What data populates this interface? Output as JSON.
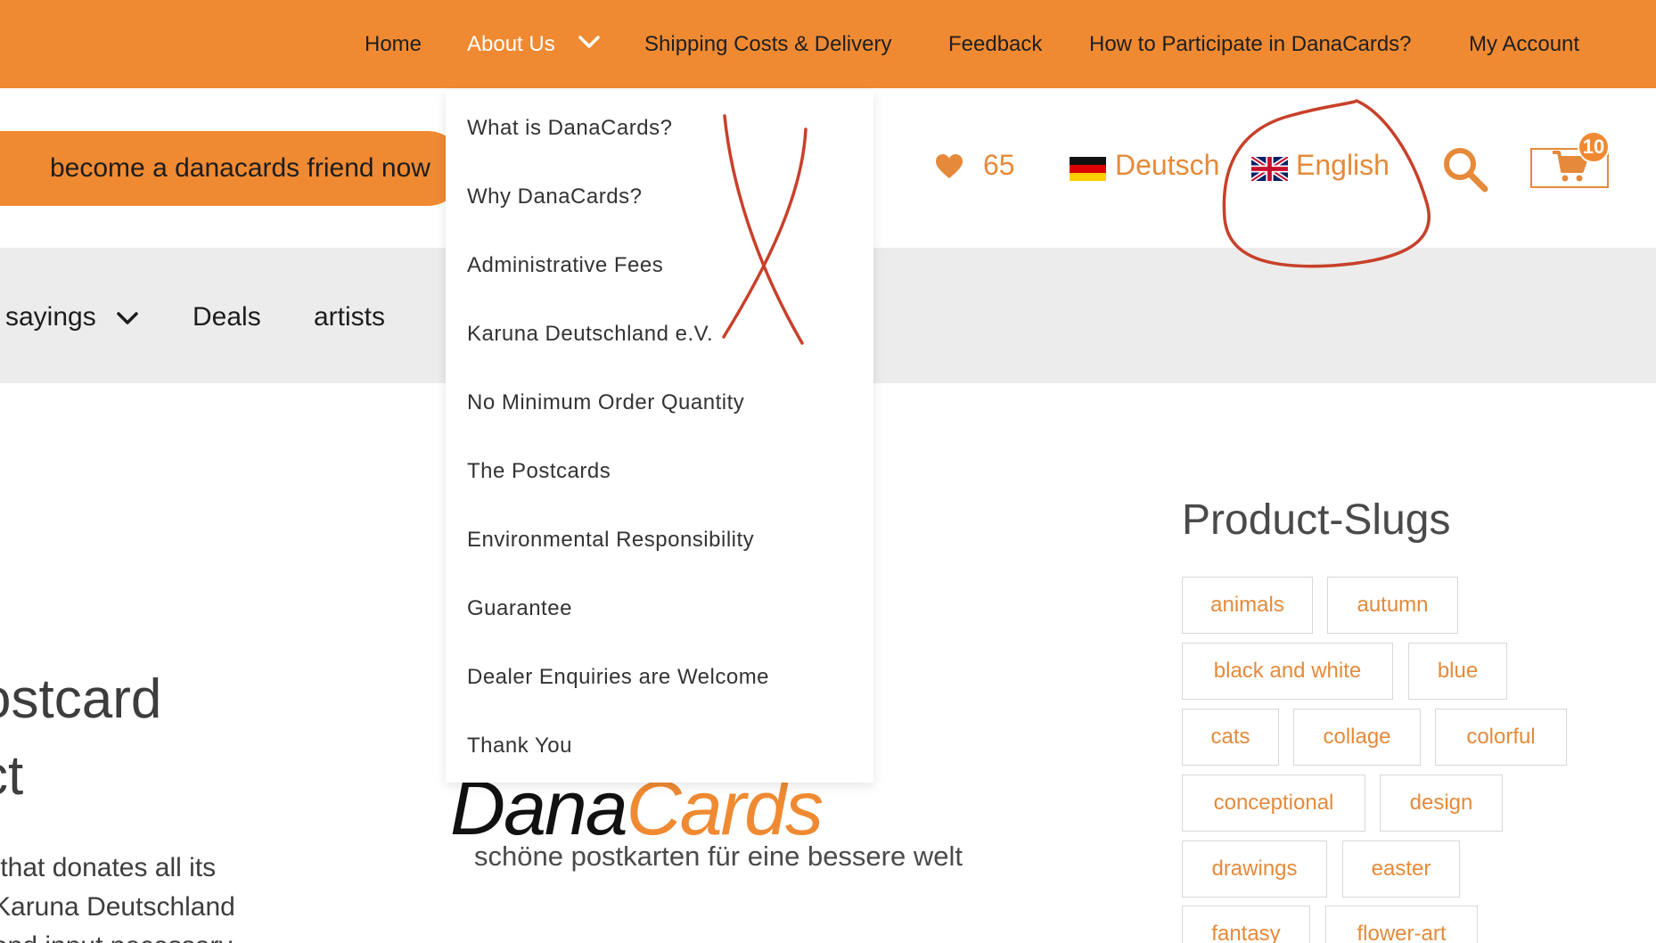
{
  "topnav": {
    "items": [
      "Home",
      "About Us",
      "Shipping Costs & Delivery",
      "Feedback",
      "How to Participate in DanaCards?",
      "My Account"
    ]
  },
  "about_menu": {
    "items": [
      "What is DanaCards?",
      "Why DanaCards?",
      "Administrative Fees",
      "Karuna Deutschland e.V.",
      "No Minimum Order Quantity",
      "The Postcards",
      "Environmental Responsibility",
      "Guarantee",
      "Dealer Enquiries are Welcome",
      "Thank You"
    ]
  },
  "header": {
    "friend_button": "become a danacards friend now",
    "wishlist_count": "65",
    "lang_de": "Deutsch",
    "lang_en": "English",
    "cart_count": "10"
  },
  "categories": {
    "items": [
      "sayings",
      "Deals",
      "artists"
    ]
  },
  "hero": {
    "title": "ostcard\nct",
    "text": " that donates all its\nKaruna Deutschland\nand input necessary"
  },
  "logo": {
    "dana": "Dana",
    "cards": "Cards",
    "tagline": "schöne postkarten für eine bessere welt"
  },
  "product_slugs": {
    "title": "Product-Slugs",
    "tags": [
      "animals",
      "autumn",
      "black and white",
      "blue",
      "cats",
      "collage",
      "colorful",
      "conceptional",
      "design",
      "drawings",
      "easter",
      "fantasy",
      "flower-art"
    ]
  },
  "colors": {
    "brand_orange": "#f08a32",
    "link_orange": "#e58a3a",
    "annotation_red": "#c8402a",
    "category_bar": "#ececec"
  }
}
